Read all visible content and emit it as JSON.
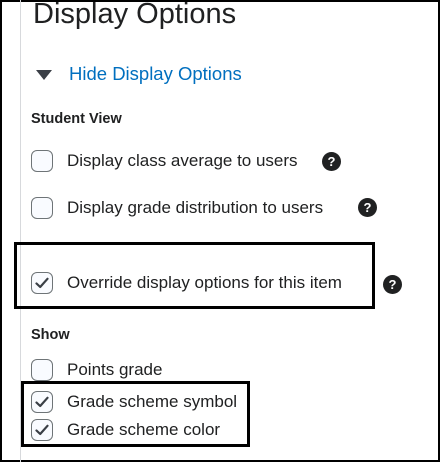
{
  "page": {
    "title": "Display Options",
    "toggle_label": "Hide Display Options"
  },
  "student_view": {
    "heading": "Student View",
    "options": [
      {
        "label": "Display class average to users",
        "checked": false,
        "help_icon": "question-circle-icon"
      },
      {
        "label": "Display grade distribution to users",
        "checked": false,
        "help_icon": "question-circle-icon"
      }
    ]
  },
  "override": {
    "label": "Override display options for this item",
    "checked": true,
    "help_icon": "question-circle-icon"
  },
  "show": {
    "heading": "Show",
    "options": [
      {
        "label": "Points grade",
        "checked": false
      },
      {
        "label": "Grade scheme symbol",
        "checked": true
      },
      {
        "label": "Grade scheme color",
        "checked": true
      }
    ]
  },
  "help_glyph": "?",
  "colors": {
    "link": "#006fbf",
    "text": "#202122",
    "highlight_border": "#000000",
    "checkbox_border": "#6e7477"
  }
}
